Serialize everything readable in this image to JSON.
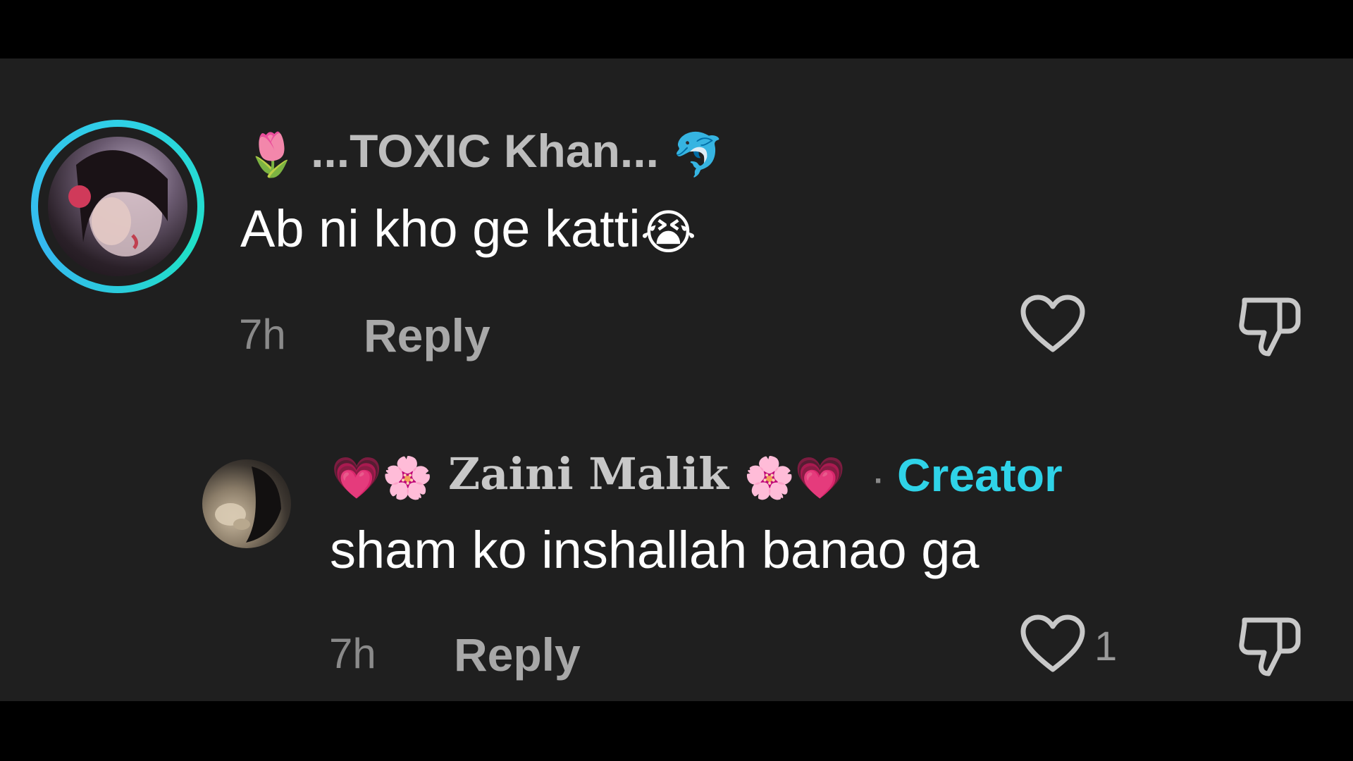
{
  "comments": [
    {
      "username": "...TOXIC Khan...",
      "username_prefix_emoji": "🌷",
      "username_suffix_emoji": "🐬",
      "text": "Ab ni kho ge katti",
      "text_emoji": "😭",
      "time": "7h",
      "reply_label": "Reply"
    },
    {
      "username": "Zaini Malik",
      "username_prefix_emoji": "💗🌸",
      "username_suffix_emoji": "🌸💗",
      "creator_separator": "·",
      "creator_label": "Creator",
      "text": "sham ko inshallah banao ga",
      "time": "7h",
      "reply_label": "Reply",
      "like_count": "1"
    }
  ],
  "colors": {
    "background": "#1f1f1f",
    "letterbox": "#000000",
    "creator_accent": "#2fd3e8",
    "avatar_ring": "#2fd0e6"
  },
  "icons": [
    "heart-outline-icon",
    "thumbs-down-icon"
  ]
}
